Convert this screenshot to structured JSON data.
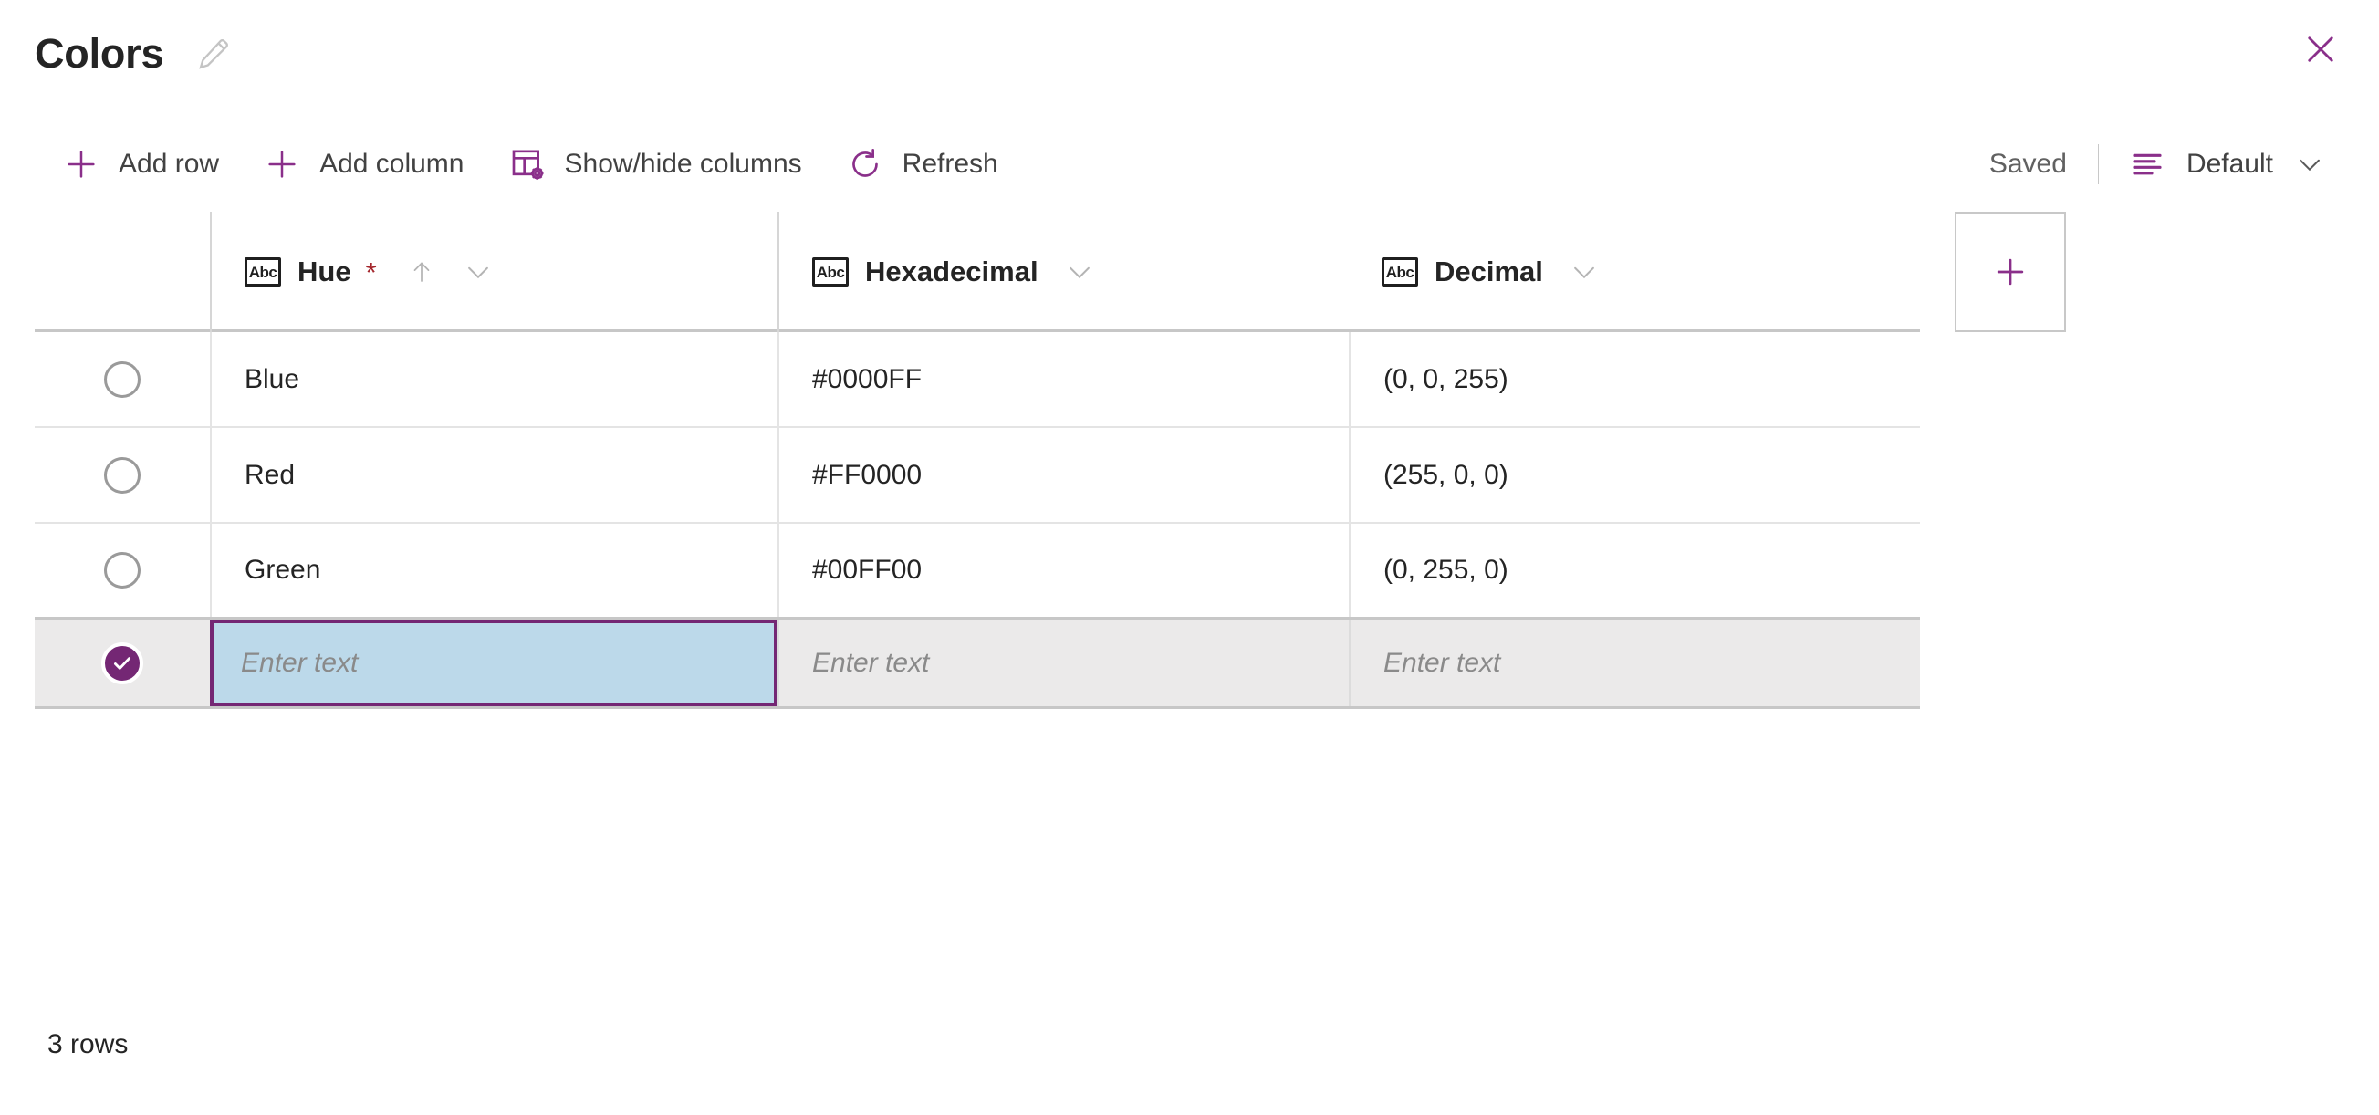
{
  "window": {
    "title": "Colors",
    "edit_icon": "pencil-icon",
    "close_icon": "close-icon"
  },
  "toolbar": {
    "items": [
      {
        "label": "Add row",
        "icon": "plus-icon"
      },
      {
        "label": "Add column",
        "icon": "plus-icon"
      },
      {
        "label": "Show/hide columns",
        "icon": "table-settings-icon"
      },
      {
        "label": "Refresh",
        "icon": "refresh-icon"
      }
    ],
    "status": "Saved",
    "view": {
      "label": "Default",
      "icon": "view-list-icon",
      "chevron": "chevron-down-icon"
    }
  },
  "grid": {
    "columns": [
      {
        "label": "Hue",
        "type_icon": "Abc",
        "required": true,
        "required_mark": "*",
        "sorted": "ascending",
        "sort_icon": "arrow-up-icon",
        "menu_icon": "chevron-down-icon"
      },
      {
        "label": "Hexadecimal",
        "type_icon": "Abc",
        "required": false,
        "required_mark": "",
        "sorted": "none",
        "sort_icon": "",
        "menu_icon": "chevron-down-icon"
      },
      {
        "label": "Decimal",
        "type_icon": "Abc",
        "required": false,
        "required_mark": "",
        "sorted": "none",
        "sort_icon": "",
        "menu_icon": "chevron-down-icon"
      }
    ],
    "add_column_icon": "plus-icon",
    "rows": [
      {
        "selected": false,
        "hue": "Blue",
        "hexadecimal": "#0000FF",
        "decimal": "(0, 0, 255)"
      },
      {
        "selected": false,
        "hue": "Red",
        "hexadecimal": "#FF0000",
        "decimal": "(255, 0, 0)"
      },
      {
        "selected": false,
        "hue": "Green",
        "hexadecimal": "#00FF00",
        "decimal": "(0, 255, 0)"
      }
    ],
    "new_row": {
      "selected": true,
      "check_icon": "check-icon",
      "hue_placeholder": "Enter text",
      "hexadecimal_placeholder": "Enter text",
      "decimal_placeholder": "Enter text",
      "active_cell": "hue"
    }
  },
  "footer": {
    "row_count_label": "3 rows"
  },
  "colors": {
    "accent": "#742774",
    "active_cell_fill": "#bcd9ea",
    "active_cell_border": "#742774",
    "selected_row_fill": "#ebeaea",
    "required_star": "#a4262c",
    "text_primary": "#242424",
    "text_secondary": "#616161",
    "grid_line": "#e4e4e4"
  }
}
